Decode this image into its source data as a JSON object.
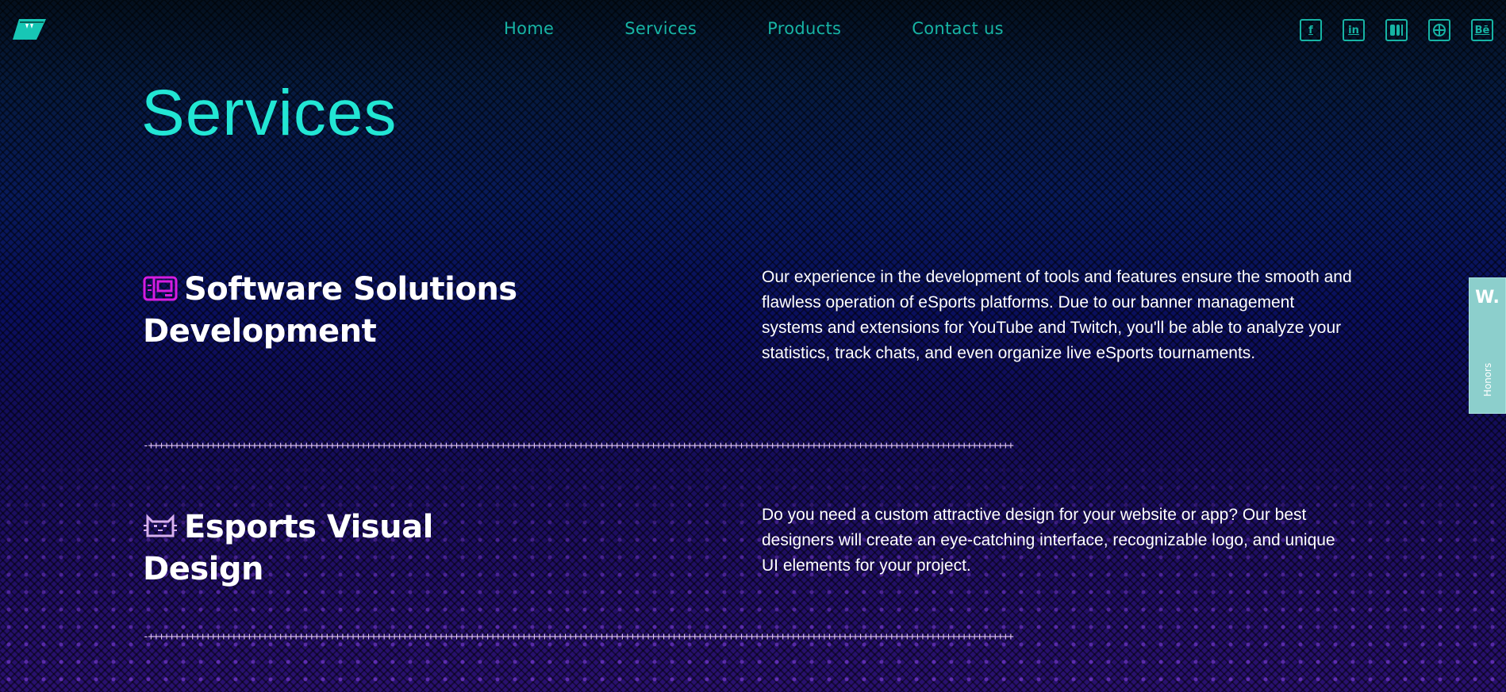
{
  "header": {
    "logo_icon": "brand-logo-icon",
    "nav": [
      {
        "label": "Home"
      },
      {
        "label": "Services"
      },
      {
        "label": "Products"
      },
      {
        "label": "Contact us"
      }
    ],
    "socials": [
      {
        "icon": "facebook-icon",
        "glyph": "f"
      },
      {
        "icon": "linkedin-icon",
        "glyph": "in"
      },
      {
        "icon": "medium-icon",
        "glyph": "▮▮▮"
      },
      {
        "icon": "dribbble-icon",
        "glyph": "⊕"
      },
      {
        "icon": "behance-icon",
        "glyph": "Bē"
      }
    ]
  },
  "page": {
    "title": "Services"
  },
  "services": [
    {
      "icon": "computer-pixel-icon",
      "icon_color": "#d61ce0",
      "title": "Software Solutions Development",
      "description": "Our experience in the development of tools and features ensure the smooth and flawless operation of eSports platforms. Due to our banner management systems and extensions for YouTube and Twitch, you'll be able to analyze your statistics, track chats, and even organize live eSports tournaments."
    },
    {
      "icon": "cat-face-pixel-icon",
      "icon_color": "#d7b0ee",
      "title": "Esports Visual Design",
      "description": "Do you need a custom attractive design for your website or app? Our best designers will create an eye-catching interface, recognizable logo, and unique UI elements for your project."
    }
  ],
  "honors_tab": {
    "badge": "W.",
    "label": "Honors"
  },
  "colors": {
    "accent_teal": "#22e6d4",
    "nav_teal": "#17b4a4",
    "divider": "#e2c6f5",
    "honors_bg": "#8ccfcc"
  }
}
